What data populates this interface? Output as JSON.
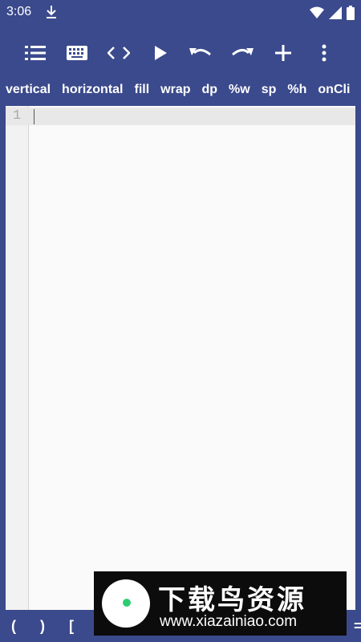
{
  "status_bar": {
    "time": "3:06",
    "icons": [
      "download-icon",
      "wifi-icon",
      "signal-icon",
      "battery-icon"
    ]
  },
  "toolbar": {
    "buttons": [
      "menu-icon",
      "keyboard-icon",
      "code-icon",
      "play-icon",
      "undo-icon",
      "redo-icon",
      "add-icon",
      "more-icon"
    ]
  },
  "snippets": [
    "vertical",
    "horizontal",
    "fill",
    "wrap",
    "dp",
    "%w",
    "sp",
    "%h",
    "onCli"
  ],
  "editor": {
    "line_numbers": [
      "1"
    ],
    "content": ""
  },
  "symbols": [
    "(",
    ")",
    "[",
    "="
  ],
  "watermark": {
    "title": "下载鸟资源",
    "url": "www.xiazainiao.com"
  },
  "colors": {
    "primary": "#3b4a8c",
    "editor_bg": "#fafafa",
    "current_line": "#e8e8e8"
  }
}
